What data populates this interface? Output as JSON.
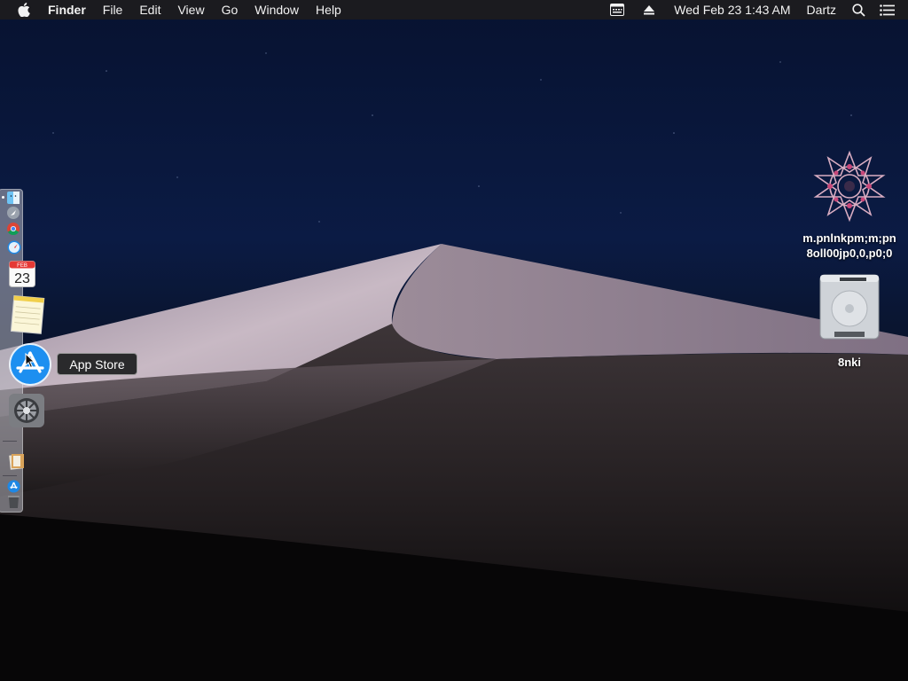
{
  "menubar": {
    "apple_icon": "apple-logo-icon",
    "app_name": "Finder",
    "items": [
      "File",
      "Edit",
      "View",
      "Go",
      "Window",
      "Help"
    ],
    "status_icons": [
      "keyboard-viewer-icon",
      "eject-icon"
    ],
    "clock": "Wed Feb 23  1:43 AM",
    "user": "Dartz",
    "search_icon": "spotlight-search-icon",
    "menu_icon": "notification-center-icon"
  },
  "dock": {
    "tooltip": "App Store",
    "calendar_month": "FEB",
    "calendar_day": "23",
    "apps": [
      "finder-icon",
      "launchpad-icon",
      "chrome-icon",
      "safari-icon",
      "calendar-icon",
      "notes-icon",
      "app-store-icon",
      "system-preferences-icon",
      "documents-stack-icon",
      "downloads-stack-icon",
      "trash-icon"
    ]
  },
  "desktop": {
    "icons": [
      {
        "label_line1": "m.pnlnkpm;m;pn",
        "label_line2": "8oll00jp0,0,p0;0",
        "icon": "star-mandala-icon"
      },
      {
        "label_line1": "8nki",
        "icon": "hard-drive-icon"
      }
    ]
  },
  "colors": {
    "menubar_bg": "#1b1b1f",
    "sky": "#0b1b44",
    "dune_light": "#b7a9b6",
    "dune_dark": "#2a2527"
  }
}
